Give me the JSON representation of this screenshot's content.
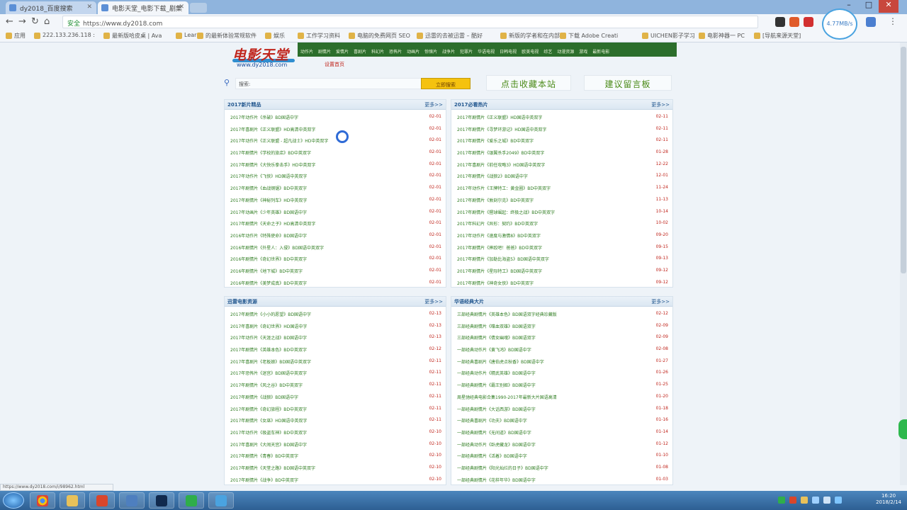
{
  "browser": {
    "tabs": [
      {
        "label": "dy2018_百度搜索"
      },
      {
        "label": "电影天堂_电影下载_剧集"
      }
    ],
    "url": "https://www.dy2018.com",
    "security_label": "安全",
    "bookmarks": [
      "应用",
      "222.133.236.118 :",
      "最新版哈皮桌 | Ava",
      "Learn",
      "的最新体验常规软件",
      "娱乐",
      "工作学习资料",
      "电脑的免费网页 SEO",
      "迅雷的去被迅雷 – 酷好",
      "新版的学者和在内部",
      "下载 Adobe Creati",
      "UICHEN影子学习",
      "电影神器一 PC",
      "[导航来源天堂]"
    ],
    "avatar_label": "4.77MB/s",
    "window_controls": {
      "min": "–",
      "max": "□",
      "close": "✕"
    }
  },
  "site": {
    "logo_text": "电影天堂",
    "logo_url": "www.dy2018.com",
    "sub_link": "设置首页",
    "nav_items": [
      "动作片",
      "剧情片",
      "爱情片",
      "喜剧片",
      "科幻片",
      "恐怖片",
      "动画片",
      "惊悚片",
      "战争片",
      "犯罪片",
      "华语电视",
      "日韩电视",
      "欧美电视",
      "综艺",
      "动漫资源",
      "游戏",
      "最新电影"
    ],
    "search_placeholder": "搜索:",
    "search_button": "立即搜索",
    "fav_button": "点击收藏本站",
    "msg_button": "建议留言板"
  },
  "sections": [
    {
      "title": "2017新片精品",
      "more": "更多>>",
      "rows": [
        {
          "title": "2017年动作片《杀破》BD国语中字",
          "date": "02-01"
        },
        {
          "title": "2017年喜剧片《正义联盟》HD高清中英双字",
          "date": "02-01"
        },
        {
          "title": "2017年动作片《正义联盟 - 超凡战士》HD中英双字",
          "date": "02-01"
        },
        {
          "title": "2017年剧情片《学校的旅店》BD中英双字",
          "date": "02-01"
        },
        {
          "title": "2017年剧情片《大快乐拳击手》HD中英双字",
          "date": "02-01"
        },
        {
          "title": "2017年动作片《飞侠》HD国语中英双字",
          "date": "02-01"
        },
        {
          "title": "2017年剧情片《血战钢锯》BD中英双字",
          "date": "02-01"
        },
        {
          "title": "2017年剧情片《神秘列车》HD中英双字",
          "date": "02-01"
        },
        {
          "title": "2017年动画片《少年英雄》BD国语中字",
          "date": "02-01"
        },
        {
          "title": "2017年剧情片《天命之子》HD高清中英双字",
          "date": "02-01"
        },
        {
          "title": "2016年动作片《特殊使命》BD国语中字",
          "date": "02-01"
        },
        {
          "title": "2016年剧情片《外星人：入侵》BD国语中英双字",
          "date": "02-01"
        },
        {
          "title": "2016年剧情片《奇幻世界》BD中英双字",
          "date": "02-01"
        },
        {
          "title": "2016年剧情片《地下城》BD中英双字",
          "date": "02-01"
        },
        {
          "title": "2016年剧情片《美梦成真》BD中英双字",
          "date": "02-01"
        }
      ]
    },
    {
      "title": "2017必看热片",
      "more": "更多>>",
      "rows": [
        {
          "title": "2017年剧情片《正义联盟》HD国语中英双字",
          "date": "02-11"
        },
        {
          "title": "2017年剧情片《寻梦环游记》HD国语中英双字",
          "date": "02-11"
        },
        {
          "title": "2017年剧情片《爱乐之城》BD中英双字",
          "date": "02-11"
        },
        {
          "title": "2017年剧情片《银翼杀手2049》BD中英双字",
          "date": "01-28"
        },
        {
          "title": "2017年喜剧片《前任攻略3》HD国语中英双字",
          "date": "12-22"
        },
        {
          "title": "2017年剧情片《战狼2》BD国语中字",
          "date": "12-01"
        },
        {
          "title": "2017年动作片《王牌特工：黄金圈》BD中英双字",
          "date": "11-24"
        },
        {
          "title": "2017年剧情片《敦刻尔克》BD中英双字",
          "date": "11-13"
        },
        {
          "title": "2017年剧情片《猩球崛起：终极之战》BD中英双字",
          "date": "10-14"
        },
        {
          "title": "2017年科幻片《异形：契约》BD中英双字",
          "date": "10-02"
        },
        {
          "title": "2017年动作片《速度与激情8》BD中英双字",
          "date": "09-20"
        },
        {
          "title": "2017年剧情片《摔跤吧！爸爸》BD中英双字",
          "date": "09-15"
        },
        {
          "title": "2017年剧情片《加勒比海盗5》BD国语中英双字",
          "date": "09-13"
        },
        {
          "title": "2017年剧情片《星际特工》BD国语中英双字",
          "date": "09-12"
        },
        {
          "title": "2017年剧情片《神奇女侠》BD中英双字",
          "date": "09-12"
        }
      ]
    },
    {
      "title": "迅雷电影资源",
      "more": "更多>>",
      "rows": [
        {
          "title": "2017年剧情片《小小的愿望》BD国语中字",
          "date": "02-13"
        },
        {
          "title": "2017年喜剧片《奇幻世界》HD国语中字",
          "date": "02-13"
        },
        {
          "title": "2017年动作片《天涯之战》BD国语中字",
          "date": "02-13"
        },
        {
          "title": "2017年剧情片《英雄本色》BD中英双字",
          "date": "02-12"
        },
        {
          "title": "2017年喜剧片《老板娘》BD国语中英双字",
          "date": "02-11"
        },
        {
          "title": "2017年恐怖片《迷宫》BD国语中英双字",
          "date": "02-11"
        },
        {
          "title": "2017年剧情片《风之谷》BD中英双字",
          "date": "02-11"
        },
        {
          "title": "2017年剧情片《战狼》BD国语中字",
          "date": "02-11"
        },
        {
          "title": "2017年剧情片《奇幻旅程》BD中英双字",
          "date": "02-11"
        },
        {
          "title": "2017年剧情片《女巫》HD国语中英双字",
          "date": "02-11"
        },
        {
          "title": "2017年动作片《极盗车神》BD中英双字",
          "date": "02-10"
        },
        {
          "title": "2017年喜剧片《大闹天宫》BD国语中字",
          "date": "02-10"
        },
        {
          "title": "2017年剧情片《青春》BD中英双字",
          "date": "02-10"
        },
        {
          "title": "2017年剧情片《天堂之路》BD国语中英双字",
          "date": "02-10"
        },
        {
          "title": "2017年剧情片《战争》BD中英双字",
          "date": "02-10"
        }
      ]
    },
    {
      "title": "华语经典大片",
      "more": "更多>>",
      "rows": [
        {
          "title": "三部经典剧情片《英雄本色》BD国语双字经典珍藏版",
          "date": "02-12"
        },
        {
          "title": "三部经典剧情片《喋血双雄》BD国语双字",
          "date": "02-09"
        },
        {
          "title": "三部经典剧情片《倩女幽魂》BD国语双字",
          "date": "02-09"
        },
        {
          "title": "一部经典动作片《黄飞鸿》BD国语中字",
          "date": "02-08"
        },
        {
          "title": "一部经典喜剧片《唐伯虎点秋香》BD国语中字",
          "date": "01-27"
        },
        {
          "title": "一部经典动作片《精武英雄》BD国语中字",
          "date": "01-26"
        },
        {
          "title": "一部经典剧情片《霸王别姬》BD国语中字",
          "date": "01-25"
        },
        {
          "title": "周星驰经典电影合集1990-2017年最新大片国语高清",
          "date": "01-20"
        },
        {
          "title": "一部经典剧情片《大话西游》BD国语中字",
          "date": "01-18"
        },
        {
          "title": "一部经典喜剧片《功夫》BD国语中字",
          "date": "01-16"
        },
        {
          "title": "一部经典剧情片《无间道》BD国语中字",
          "date": "01-14"
        },
        {
          "title": "一部经典动作片《卧虎藏龙》BD国语中字",
          "date": "01-12"
        },
        {
          "title": "一部经典剧情片《活着》BD国语中字",
          "date": "01-10"
        },
        {
          "title": "一部经典剧情片《阳光灿烂的日子》BD国语中字",
          "date": "01-08"
        },
        {
          "title": "一部经典剧情片《花样年华》BD国语中字",
          "date": "01-03"
        }
      ]
    }
  ],
  "status_text": "https://www.dy2018.com/i/98962.html",
  "clock": {
    "time": "16:20",
    "date": "2018/2/14"
  }
}
